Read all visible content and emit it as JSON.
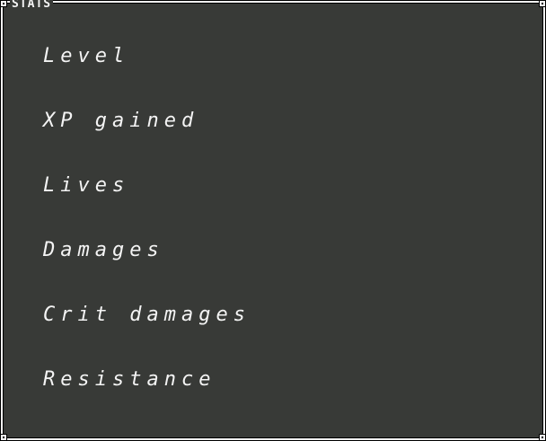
{
  "window": {
    "title": "STATS"
  },
  "stats": [
    {
      "label": "Level"
    },
    {
      "label": "XP gained"
    },
    {
      "label": "Lives"
    },
    {
      "label": "Damages"
    },
    {
      "label": "Crit damages"
    },
    {
      "label": "Resistance"
    }
  ],
  "colors": {
    "panel_background": "#383a37",
    "frame": "#f4f4f4",
    "text": "#f4f4f4"
  }
}
